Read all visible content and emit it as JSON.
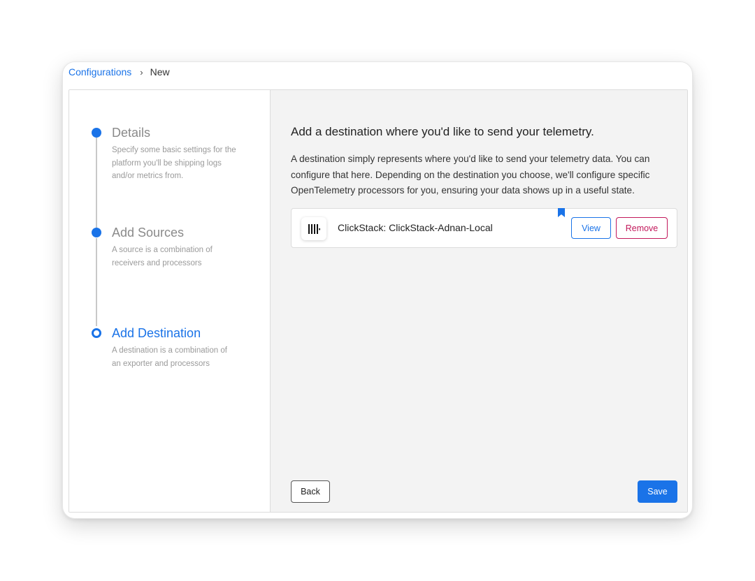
{
  "breadcrumb": {
    "root": "Configurations",
    "separator": "›",
    "current": "New"
  },
  "steps": [
    {
      "title": "Details",
      "description": "Specify some basic settings for the platform you'll be shipping logs and/or metrics from.",
      "state": "done"
    },
    {
      "title": "Add Sources",
      "description": "A source is a combination of receivers and processors",
      "state": "done"
    },
    {
      "title": "Add Destination",
      "description": "A destination is a combination of an exporter and processors",
      "state": "current"
    }
  ],
  "main": {
    "heading": "Add a destination where you'd like to send your telemetry.",
    "intro": "A destination simply represents where you'd like to send your telemetry data. You can configure that here. Depending on the destination you choose, we'll configure specific OpenTelemetry processors for you, ensuring your data shows up in a useful state.",
    "destination": {
      "name": "ClickStack: ClickStack-Adnan-Local",
      "icon": "clickstack-logo-icon",
      "view_label": "View",
      "remove_label": "Remove"
    },
    "back_label": "Back",
    "save_label": "Save"
  },
  "colors": {
    "accent": "#1a73e8",
    "danger": "#c2185b",
    "main_bg": "#f3f3f3"
  }
}
